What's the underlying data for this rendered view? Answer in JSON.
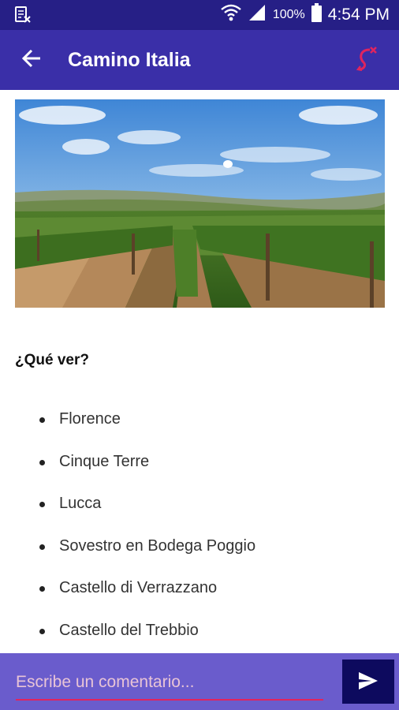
{
  "status_bar": {
    "time": "4:54 PM",
    "battery": "100%",
    "icons": [
      "sim-no-signal-icon",
      "wifi-icon",
      "cell-signal-icon",
      "battery-icon"
    ]
  },
  "app_bar": {
    "title": "Camino Italia",
    "back_icon": "arrow-back-icon",
    "action_icon": "route-icon",
    "action_color": "#e0245e"
  },
  "main": {
    "hero_image": "vineyard-landscape",
    "heading": "¿Qué ver?",
    "places": [
      "Florence",
      "Cinque Terre",
      "Lucca",
      "Sovestro en Bodega Poggio",
      "Castello di Verrazzano",
      "Castello del Trebbio"
    ]
  },
  "comment_bar": {
    "placeholder": "Escribe un comentario...",
    "value": "",
    "send_icon": "send-icon"
  },
  "colors": {
    "status_bar": "#261f86",
    "app_bar": "#3a2fa8",
    "comment_bar": "#6a5ccc",
    "send_button": "#0d0a5e",
    "accent": "#e0245e"
  }
}
